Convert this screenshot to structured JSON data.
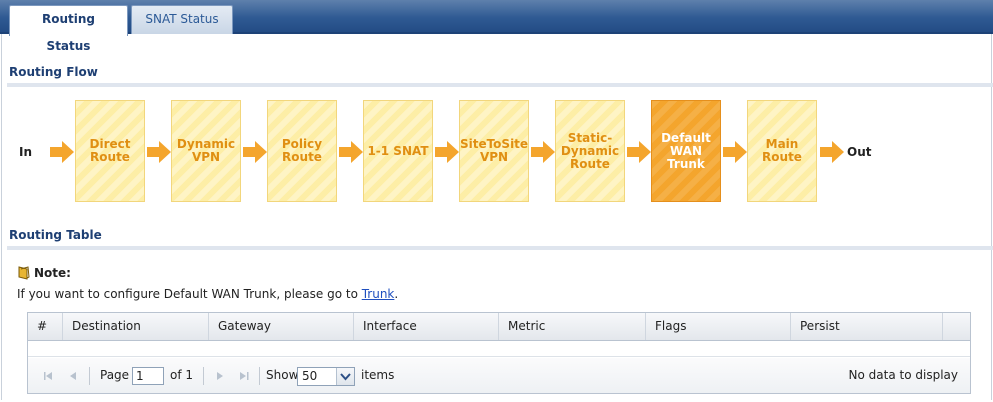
{
  "tabs": [
    {
      "label": "Routing Status",
      "active": true
    },
    {
      "label": "SNAT Status",
      "active": false
    }
  ],
  "routing_flow": {
    "title": "Routing Flow",
    "start_label": "In",
    "end_label": "Out",
    "steps": [
      {
        "label": "Direct Route",
        "highlighted": false
      },
      {
        "label": "Dynamic VPN",
        "highlighted": false
      },
      {
        "label": "Policy Route",
        "highlighted": false
      },
      {
        "label": "1-1 SNAT",
        "highlighted": false
      },
      {
        "label": "SiteToSite VPN",
        "highlighted": false
      },
      {
        "label": "Static-Dynamic Route",
        "highlighted": false
      },
      {
        "label": "Default WAN Trunk",
        "highlighted": true
      },
      {
        "label": "Main Route",
        "highlighted": false
      }
    ]
  },
  "routing_table": {
    "title": "Routing Table",
    "note": {
      "title": "Note:",
      "text_before": "If you want to configure Default WAN Trunk, please go to ",
      "link": "Trunk",
      "text_after": "."
    },
    "columns": [
      "#",
      "Destination",
      "Gateway",
      "Interface",
      "Metric",
      "Flags",
      "Persist"
    ],
    "rows": [],
    "pager": {
      "page_label": "Page",
      "page_value": "1",
      "of_label": "of 1",
      "show_label": "Show",
      "show_value": "50",
      "items_label": "items",
      "empty_message": "No data to display"
    }
  },
  "colors": {
    "tab_bar": "#2f5a93",
    "flow_box": "#fdeea6",
    "flow_box_text": "#e08f12",
    "flow_box_highlight": "#f4a52d",
    "arrow": "#f4a52d",
    "section_title": "#1e3f73"
  },
  "icons": {
    "flow_arrow": "arrow-right-icon",
    "note": "note-icon",
    "pager_first": "first-page-icon",
    "pager_prev": "previous-page-icon",
    "pager_next": "next-page-icon",
    "pager_last": "last-page-icon",
    "select": "chevron-down-icon"
  }
}
